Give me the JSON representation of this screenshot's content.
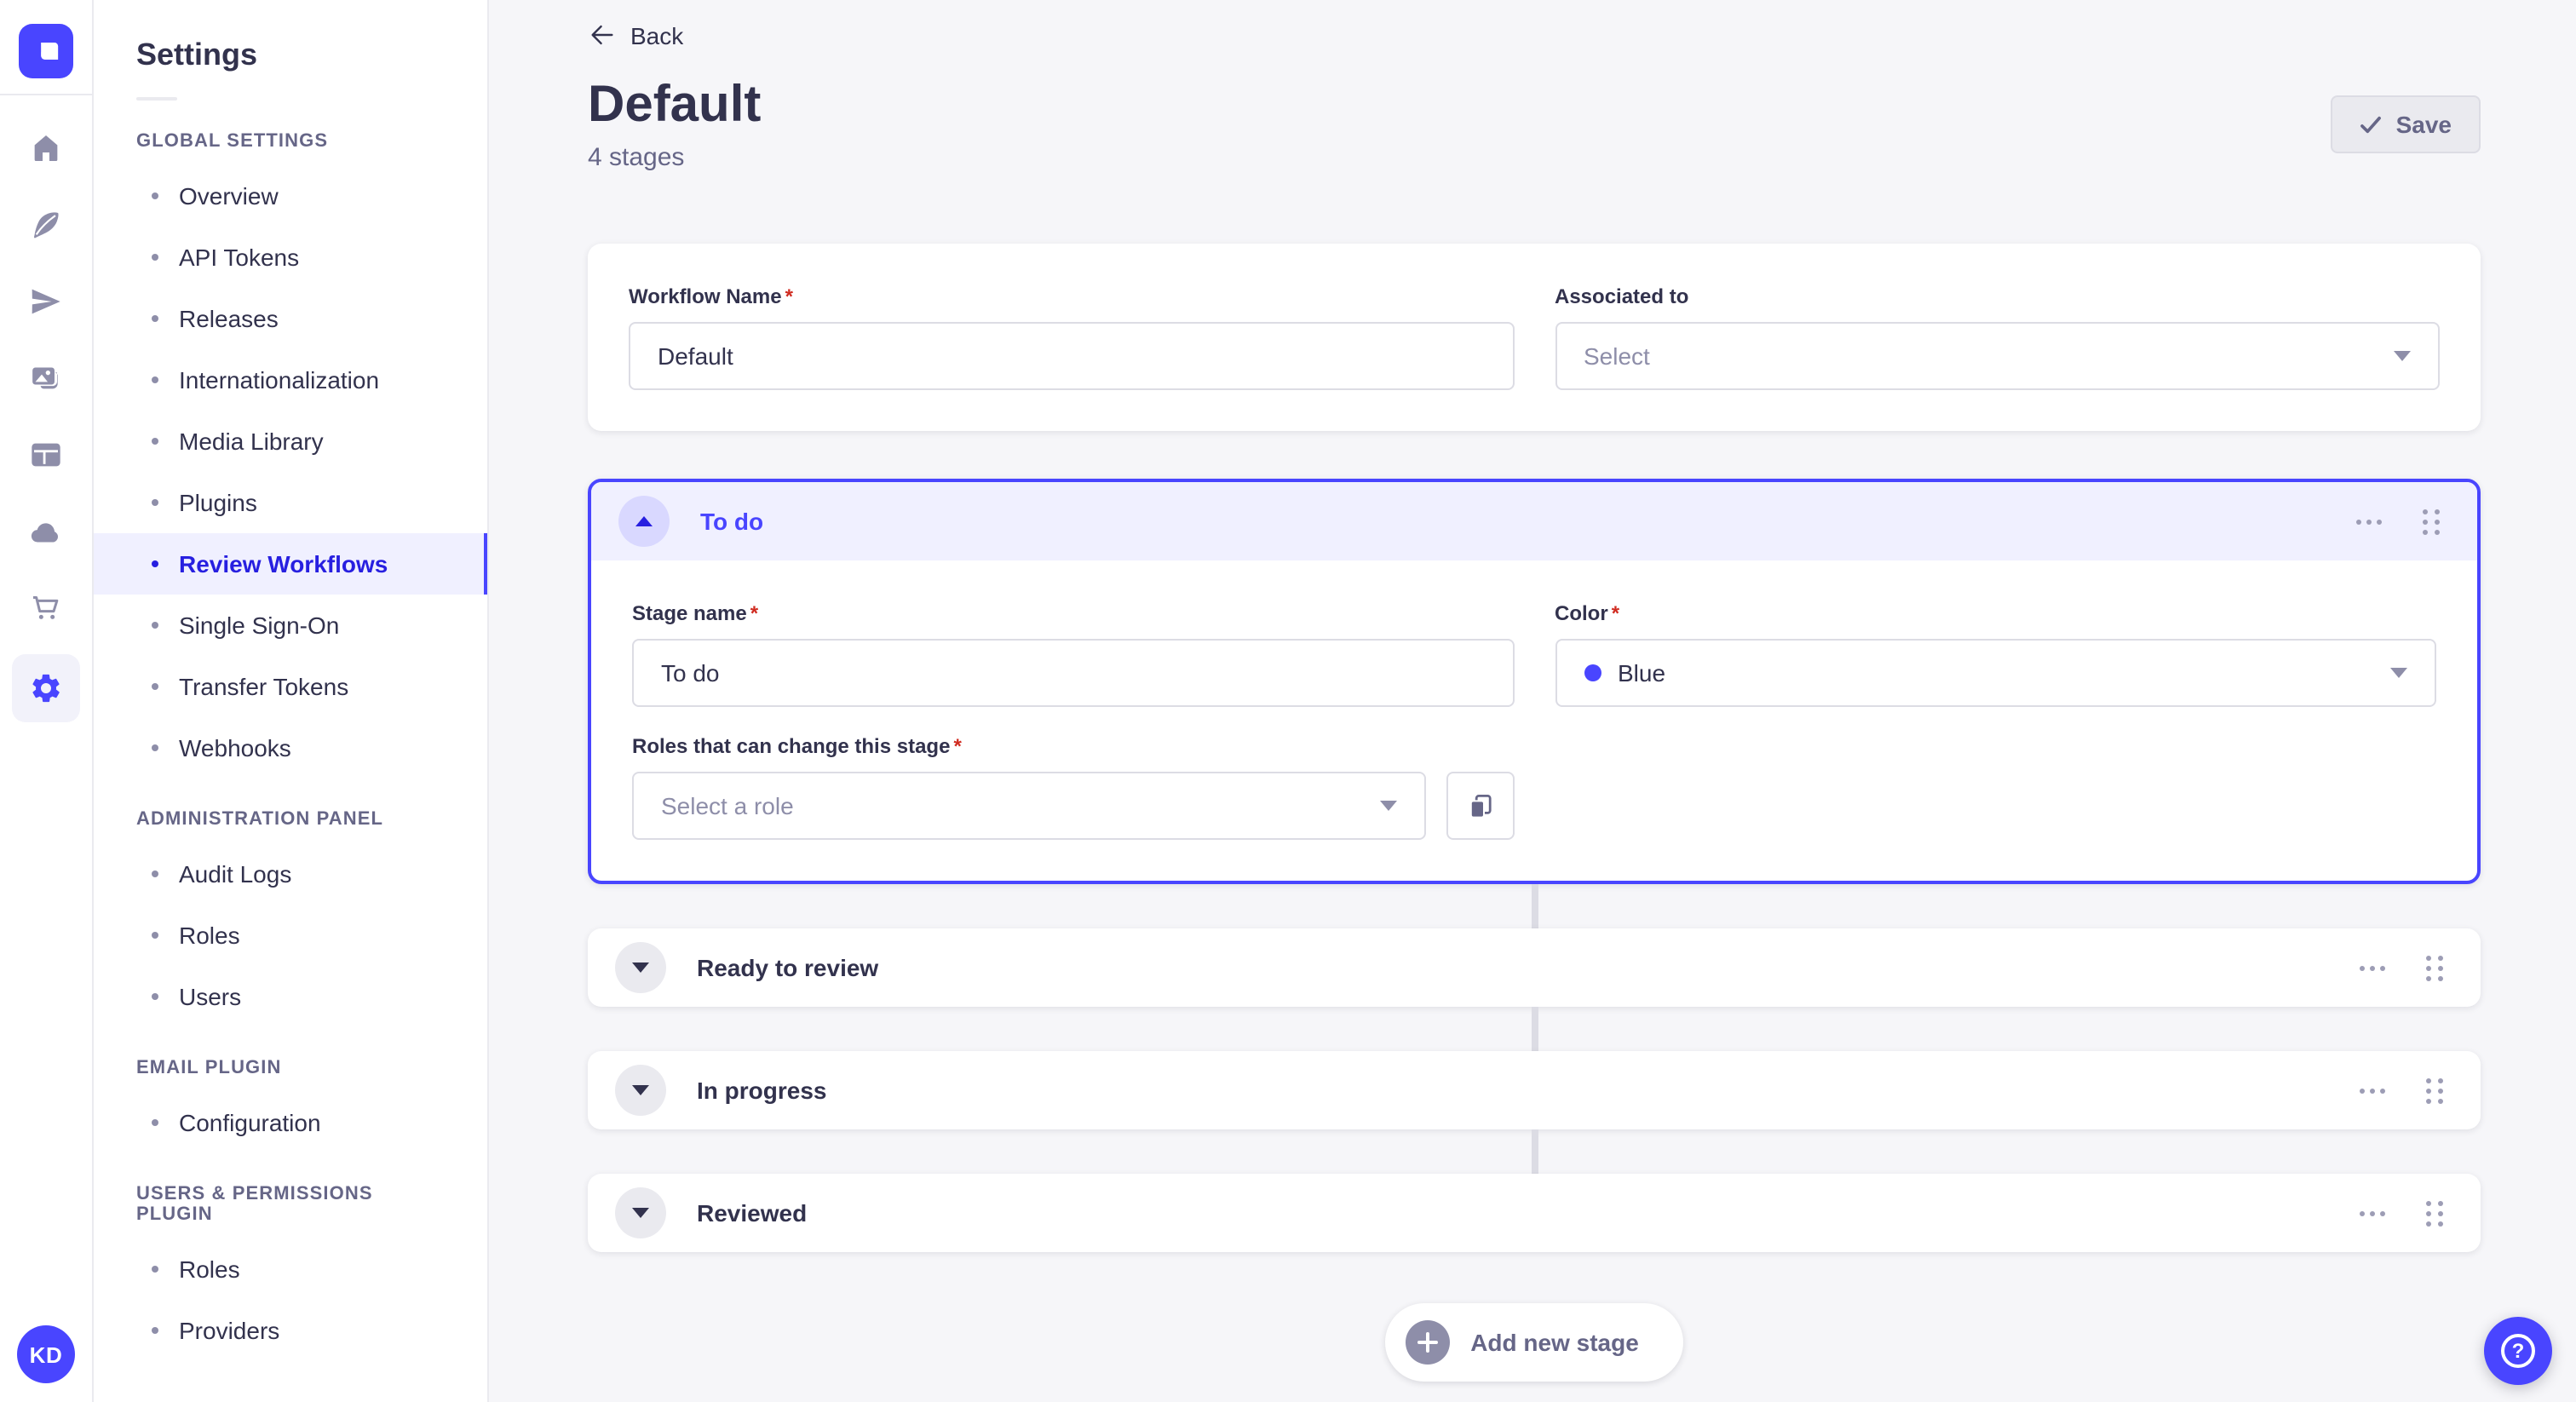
{
  "colors": {
    "primary": "#4945FF",
    "primary_text_active": "#271FE0",
    "primary_bg_light": "#F0F0FF",
    "primary_bg_soft": "#D9D8FF",
    "required_red": "#D02B20",
    "stage_color_hex": "#4945FF"
  },
  "rail": {
    "avatar_initials": "KD"
  },
  "nav": {
    "title": "Settings",
    "sections": [
      {
        "label": "GLOBAL SETTINGS",
        "items": [
          {
            "label": "Overview"
          },
          {
            "label": "API Tokens"
          },
          {
            "label": "Releases"
          },
          {
            "label": "Internationalization"
          },
          {
            "label": "Media Library"
          },
          {
            "label": "Plugins"
          },
          {
            "label": "Review Workflows",
            "active": true
          },
          {
            "label": "Single Sign-On"
          },
          {
            "label": "Transfer Tokens"
          },
          {
            "label": "Webhooks"
          }
        ]
      },
      {
        "label": "ADMINISTRATION PANEL",
        "items": [
          {
            "label": "Audit Logs"
          },
          {
            "label": "Roles"
          },
          {
            "label": "Users"
          }
        ]
      },
      {
        "label": "EMAIL PLUGIN",
        "items": [
          {
            "label": "Configuration"
          }
        ]
      },
      {
        "label": "USERS & PERMISSIONS PLUGIN",
        "items": [
          {
            "label": "Roles"
          },
          {
            "label": "Providers"
          }
        ]
      }
    ]
  },
  "header": {
    "back": "Back",
    "title": "Default",
    "subtitle": "4 stages",
    "save": "Save"
  },
  "required_marker": "*",
  "form": {
    "workflow_name": {
      "label": "Workflow Name",
      "value": "Default"
    },
    "associated_to": {
      "label": "Associated to",
      "placeholder": "Select"
    }
  },
  "stages": {
    "expanded": {
      "title": "To do",
      "stage_name": {
        "label": "Stage name",
        "value": "To do"
      },
      "color": {
        "label": "Color",
        "value": "Blue",
        "dot_style": "background:#4945FF"
      },
      "roles": {
        "label": "Roles that can change this stage",
        "placeholder": "Select a role"
      }
    },
    "collapsed": [
      {
        "title": "Ready to review"
      },
      {
        "title": "In progress"
      },
      {
        "title": "Reviewed"
      }
    ]
  },
  "footer": {
    "add_stage": "Add new stage",
    "help_glyph": "?"
  }
}
